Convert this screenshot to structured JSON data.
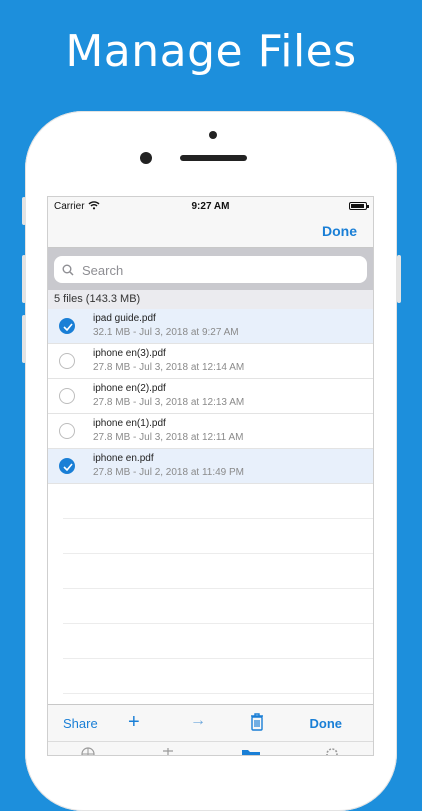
{
  "headline": "Manage Files",
  "status": {
    "carrier": "Carrier",
    "time": "9:27 AM"
  },
  "navbar": {
    "done_label": "Done"
  },
  "search": {
    "placeholder": "Search"
  },
  "summary": "5 files (143.3 MB)",
  "files": [
    {
      "name": "ipad guide.pdf",
      "meta": "32.1 MB - Jul 3, 2018 at 9:27 AM",
      "selected": true
    },
    {
      "name": "iphone  en(3).pdf",
      "meta": "27.8 MB - Jul 3, 2018 at 12:14 AM",
      "selected": false
    },
    {
      "name": "iphone  en(2).pdf",
      "meta": "27.8 MB - Jul 3, 2018 at 12:13 AM",
      "selected": false
    },
    {
      "name": "iphone  en(1).pdf",
      "meta": "27.8 MB - Jul 3, 2018 at 12:11 AM",
      "selected": false
    },
    {
      "name": "iphone  en.pdf",
      "meta": "27.8 MB - Jul 2, 2018 at 11:49 PM",
      "selected": true
    }
  ],
  "toolbar": {
    "share_label": "Share",
    "add_icon": "+",
    "move_icon": "→",
    "done_label": "Done"
  },
  "icons": {
    "add": "plus-icon",
    "move": "arrow-right-icon",
    "trash": "trash-icon",
    "tabs": [
      "globe-icon",
      "transfer-icon",
      "folder-icon",
      "gear-icon"
    ]
  },
  "colors": {
    "background": "#1d8fdc",
    "accent": "#1a7fd6",
    "selected_row": "#e8f0fb"
  }
}
